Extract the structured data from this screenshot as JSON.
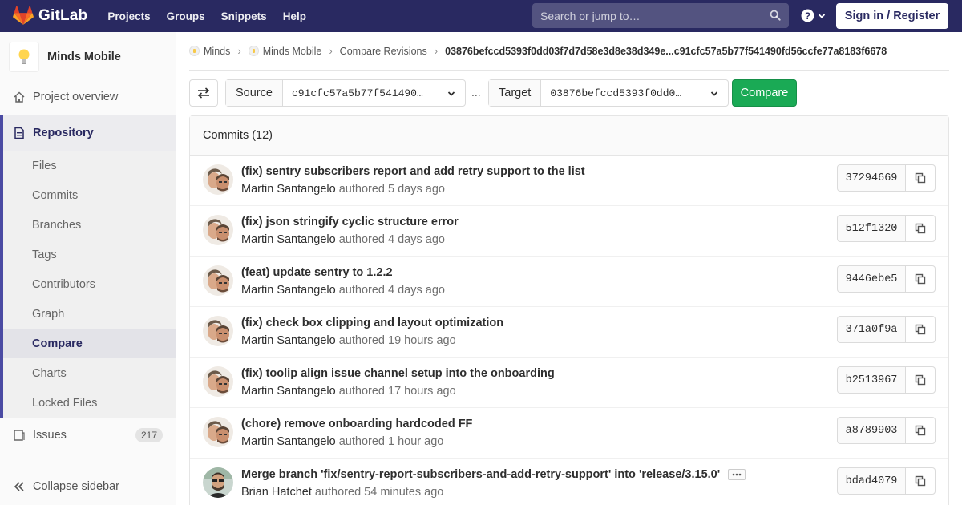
{
  "navbar": {
    "brand": "GitLab",
    "links": [
      "Projects",
      "Groups",
      "Snippets",
      "Help"
    ],
    "search_placeholder": "Search or jump to…",
    "signin": "Sign in / Register"
  },
  "sidebar": {
    "project_name": "Minds Mobile",
    "project_overview": "Project overview",
    "repository": "Repository",
    "repo_items": [
      "Files",
      "Commits",
      "Branches",
      "Tags",
      "Contributors",
      "Graph",
      "Compare",
      "Charts",
      "Locked Files"
    ],
    "active_item": "Compare",
    "issues": "Issues",
    "issues_count": "217",
    "collapse": "Collapse sidebar"
  },
  "breadcrumb": {
    "items": [
      "Minds",
      "Minds Mobile",
      "Compare Revisions"
    ],
    "current": "03876befccd5393f0dd03f7d7d58e3d8e38d349e...c91cfc57a5b77f541490fd56ccfe77a8183f6678"
  },
  "compare": {
    "source_label": "Source",
    "source_value": "c91cfc57a5b77f541490…",
    "separator": "...",
    "target_label": "Target",
    "target_value": "03876befccd5393f0dd0…",
    "button": "Compare"
  },
  "commits": {
    "header": "Commits (12)",
    "items": [
      {
        "title": "(fix) sentry subscribers report and add retry support to the list",
        "author": "Martin Santangelo",
        "verb": "authored",
        "time": "5 days ago",
        "sha": "37294669"
      },
      {
        "title": "(fix) json stringify cyclic structure error",
        "author": "Martin Santangelo",
        "verb": "authored",
        "time": "4 days ago",
        "sha": "512f1320"
      },
      {
        "title": "(feat) update sentry to 1.2.2",
        "author": "Martin Santangelo",
        "verb": "authored",
        "time": "4 days ago",
        "sha": "9446ebe5"
      },
      {
        "title": "(fix) check box clipping and layout optimization",
        "author": "Martin Santangelo",
        "verb": "authored",
        "time": "19 hours ago",
        "sha": "371a0f9a"
      },
      {
        "title": "(fix) toolip align issue channel setup into the onboarding",
        "author": "Martin Santangelo",
        "verb": "authored",
        "time": "17 hours ago",
        "sha": "b2513967"
      },
      {
        "title": "(chore) remove onboarding hardcoded FF",
        "author": "Martin Santangelo",
        "verb": "authored",
        "time": "1 hour ago",
        "sha": "a8789903"
      },
      {
        "title": "Merge branch 'fix/sentry-report-subscribers-and-add-retry-support' into 'release/3.15.0'",
        "author": "Brian Hatchet",
        "verb": "authored",
        "time": "54 minutes ago",
        "sha": "bdad4079"
      }
    ]
  },
  "colors": {
    "navbar": "#292961",
    "accent": "#4b4ba3",
    "compare_button": "#1aaa55"
  }
}
